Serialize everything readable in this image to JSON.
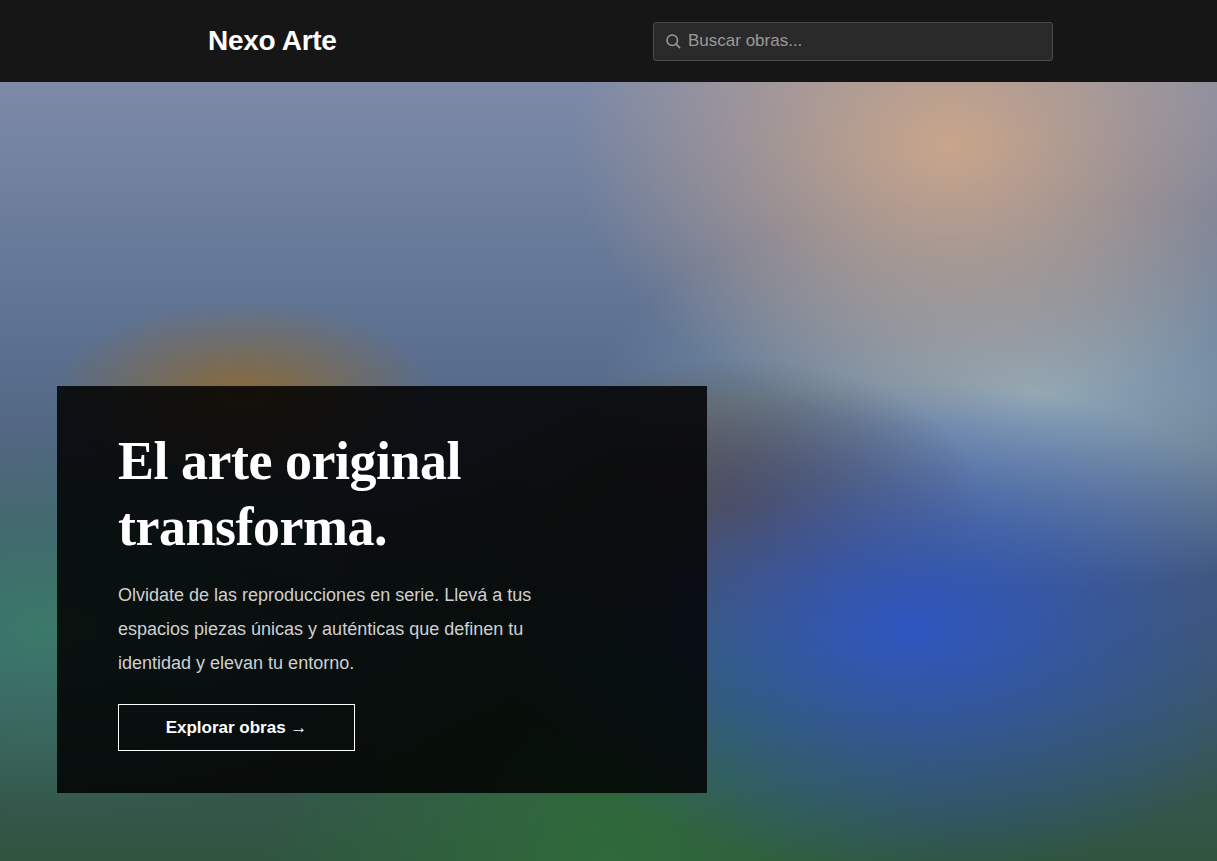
{
  "header": {
    "brand": "Nexo Arte"
  },
  "search": {
    "placeholder": "Buscar obras..."
  },
  "hero": {
    "title": "El arte original transforma.",
    "description": "Olvidate de las reproducciones en serie. Llevá a tus espacios piezas únicas y auténticas que definen tu identidad y elevan tu entorno.",
    "button": "Explorar obras →"
  }
}
